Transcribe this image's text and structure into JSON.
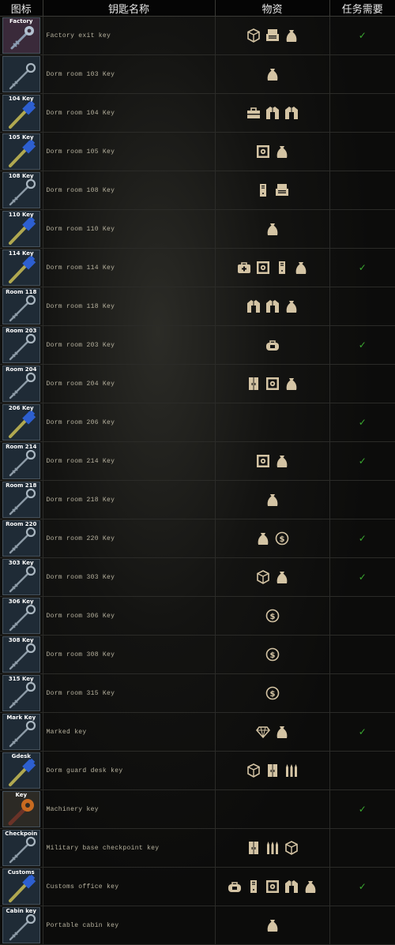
{
  "header": {
    "icon": "图标",
    "name": "钥匙名称",
    "loot": "物资",
    "quest": "任务需要"
  },
  "colors": {
    "check": "#3aa830",
    "loot_icon": "#d4c4a4",
    "name_text": "#b7b29f"
  },
  "check_mark": "✓",
  "rows": [
    {
      "label": "Factory",
      "style": "factory",
      "name": "Factory exit key",
      "loot": [
        "box",
        "printer",
        "bag"
      ],
      "quest": true
    },
    {
      "label": "",
      "style": "plain",
      "name": "Dorm room 103 Key",
      "loot": [
        "bag"
      ],
      "quest": false
    },
    {
      "label": "104 Key",
      "style": "blue",
      "name": "Dorm room 104 Key",
      "loot": [
        "toolbox",
        "jacket",
        "jacket"
      ],
      "quest": false
    },
    {
      "label": "105 Key",
      "style": "blue",
      "name": "Dorm room 105 Key",
      "loot": [
        "safe",
        "bag"
      ],
      "quest": false
    },
    {
      "label": "108 Key",
      "style": "silver",
      "name": "Dorm room 108 Key",
      "loot": [
        "pc",
        "printer"
      ],
      "quest": false
    },
    {
      "label": "110 Key",
      "style": "blue",
      "name": "Dorm room 110 Key",
      "loot": [
        "bag"
      ],
      "quest": false
    },
    {
      "label": "114 Key",
      "style": "blue",
      "name": "Dorm room 114 Key",
      "loot": [
        "medbag",
        "safe",
        "pc",
        "bag"
      ],
      "quest": true
    },
    {
      "label": "Room 118",
      "style": "silver",
      "name": "Dorm room 118 Key",
      "loot": [
        "jacket",
        "jacket",
        "bag"
      ],
      "quest": false
    },
    {
      "label": "Room 203",
      "style": "silver",
      "name": "Dorm room 203 Key",
      "loot": [
        "bag2"
      ],
      "quest": true
    },
    {
      "label": "Room 204",
      "style": "silver",
      "name": "Dorm room 204 Key",
      "loot": [
        "cabinet",
        "safe",
        "bag"
      ],
      "quest": false
    },
    {
      "label": "206 Key",
      "style": "blue",
      "name": "Dorm room 206 Key",
      "loot": [],
      "quest": true
    },
    {
      "label": "Room 214",
      "style": "silver",
      "name": "Dorm room 214 Key",
      "loot": [
        "safe",
        "bag"
      ],
      "quest": true
    },
    {
      "label": "Room 218",
      "style": "silver",
      "name": "Dorm room 218 Key",
      "loot": [
        "bag"
      ],
      "quest": false
    },
    {
      "label": "Room 220",
      "style": "silver",
      "name": "Dorm room 220 Key",
      "loot": [
        "bag",
        "coin"
      ],
      "quest": true
    },
    {
      "label": "303 Key",
      "style": "silver",
      "name": "Dorm room 303 Key",
      "loot": [
        "box",
        "bag"
      ],
      "quest": true
    },
    {
      "label": "306 Key",
      "style": "silver",
      "name": "Dorm room 306 Key",
      "loot": [
        "coin"
      ],
      "quest": false
    },
    {
      "label": "308 Key",
      "style": "silver",
      "name": "Dorm room 308 Key",
      "loot": [
        "coin"
      ],
      "quest": false
    },
    {
      "label": "315 Key",
      "style": "silver",
      "name": "Dorm room 315 Key",
      "loot": [
        "coin"
      ],
      "quest": false
    },
    {
      "label": "Mark Key",
      "style": "silver",
      "name": "Marked key",
      "loot": [
        "diamond",
        "bag"
      ],
      "quest": true
    },
    {
      "label": "Gdesk",
      "style": "blue",
      "name": "Dorm guard desk key",
      "loot": [
        "box",
        "cabinet",
        "ammo"
      ],
      "quest": false
    },
    {
      "label": "Key",
      "style": "machinery",
      "name": "Machinery key",
      "loot": [],
      "quest": true
    },
    {
      "label": "Checkpoin",
      "style": "silver",
      "name": "Military base checkpoint key",
      "loot": [
        "cabinet",
        "ammo",
        "box"
      ],
      "quest": false
    },
    {
      "label": "Customs",
      "style": "blue",
      "name": "Customs office key",
      "loot": [
        "bag2",
        "pc",
        "safe",
        "jacket",
        "bag"
      ],
      "quest": true
    },
    {
      "label": "Cabin key",
      "style": "silver",
      "name": "Portable cabin key",
      "loot": [
        "bag"
      ],
      "quest": false
    }
  ]
}
